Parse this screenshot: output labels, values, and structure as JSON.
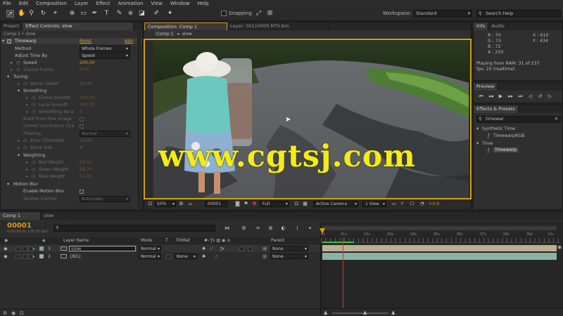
{
  "menu": [
    "File",
    "Edit",
    "Composition",
    "Layer",
    "Effect",
    "Animation",
    "View",
    "Window",
    "Help"
  ],
  "toolbar": {
    "snapping_label": "Snapping",
    "workspace_label": "Workspace:",
    "workspace_value": "Standard",
    "search_placeholder": "Search Help"
  },
  "left_panel": {
    "tabs": [
      "Project",
      "Effect Controls: slow"
    ],
    "header": "Comp 1 • slow",
    "effect_name": "Timewarp",
    "reset_label": "Reset",
    "about_label": "Abo",
    "method_label": "Method",
    "method_value": "Whole Frames",
    "adjust_label": "Adjust Time By",
    "adjust_value": "Speed",
    "speed_label": "Speed",
    "speed_value": "200.00",
    "source_frame_label": "Source Frame",
    "source_frame_value": "0.00",
    "tuning_label": "Tuning",
    "vector_detail_label": "Vector Detail",
    "vector_detail_value": "20.00",
    "smoothing_label": "Smoothing",
    "global_smooth_label": "Global Smooth",
    "global_smooth_value": "500.00",
    "local_smooth_label": "Local Smooth",
    "local_smooth_value": "500.00",
    "smoothing_iter_label": "Smoothing Itera",
    "smoothing_iter_value": "3",
    "build_from_one_label": "Build From One Image",
    "correct_luminance_label": "Correct Luminance Cha",
    "filtering_label": "Filtering",
    "filtering_value": "Normal",
    "error_threshold_label": "Error Threshold",
    "error_threshold_value": "10.00",
    "block_size_label": "Block Size",
    "block_size_value": "8",
    "weighting_label": "Weighting",
    "red_weight_label": "Red Weight",
    "red_weight_value": "29.91",
    "green_weight_label": "Green Weight",
    "green_weight_value": "58.70",
    "blue_weight_label": "Blue Weight",
    "blue_weight_value": "11.41",
    "motion_blur_label": "Motion Blur",
    "enable_motion_blur_label": "Enable Motion Blur",
    "shutter_control_label": "Shutter Control",
    "shutter_control_value": "Automatic"
  },
  "viewer": {
    "tab_label": "Composition: Comp 1",
    "layer_tab_label": "Layer: 00110000.MTS.bm",
    "crumbs": [
      "Comp 1",
      "slow"
    ],
    "zoom": "50%",
    "timecode": "00001",
    "resolution": "Full",
    "camera": "Active Camera",
    "view": "1 View",
    "exposure": "+0.0",
    "watermark": "www.cgtsj.com"
  },
  "info_panel": {
    "tabs": [
      "Info",
      "Audio"
    ],
    "r": "R : 70",
    "g": "G : 73",
    "b": "B : 72",
    "a": "A : 255",
    "x": "X : 610",
    "y": "Y : 434",
    "status_line1": "Playing from RAM: 31 of 237",
    "status_line2": "fps: 25 (realtime)"
  },
  "preview_panel": {
    "tab": "Preview"
  },
  "effects_panel": {
    "tab": "Effects & Presets",
    "search_value": "timewar",
    "category1": "Synthetic Time",
    "item1": "TimewarpRGB",
    "category2": "Time",
    "item2": "Timewarp"
  },
  "timeline": {
    "tabs": [
      "Comp 1",
      "slow"
    ],
    "timecode": "00001",
    "timecode_sub": "0:00:00:01 (25.00 fps)",
    "search_placeholder": "",
    "col_layer_name": "Layer Name",
    "col_mode": "Mode",
    "col_t": "T",
    "col_trkmat": "TrkMat",
    "col_parent": "Parent",
    "layers": [
      {
        "num": "1",
        "name": "slow",
        "mode": "Normal",
        "trkmat": "",
        "parent": "None",
        "color": "#8aa3b3"
      },
      {
        "num": "2",
        "name": "[BG]",
        "mode": "Normal",
        "trkmat": "None",
        "parent": "None",
        "color": "#8fb4a7"
      }
    ],
    "ruler": [
      "0s",
      "01s",
      "02s",
      "03s",
      "04s",
      "05s",
      "06s",
      "07s",
      "08s",
      "09s",
      "10s"
    ]
  },
  "colors": {
    "accent": "#d69b1f",
    "watermark": "#f3ec18",
    "bar1": "#bcae93",
    "bar2": "#8ab5a5",
    "playhead": "#e23030"
  }
}
